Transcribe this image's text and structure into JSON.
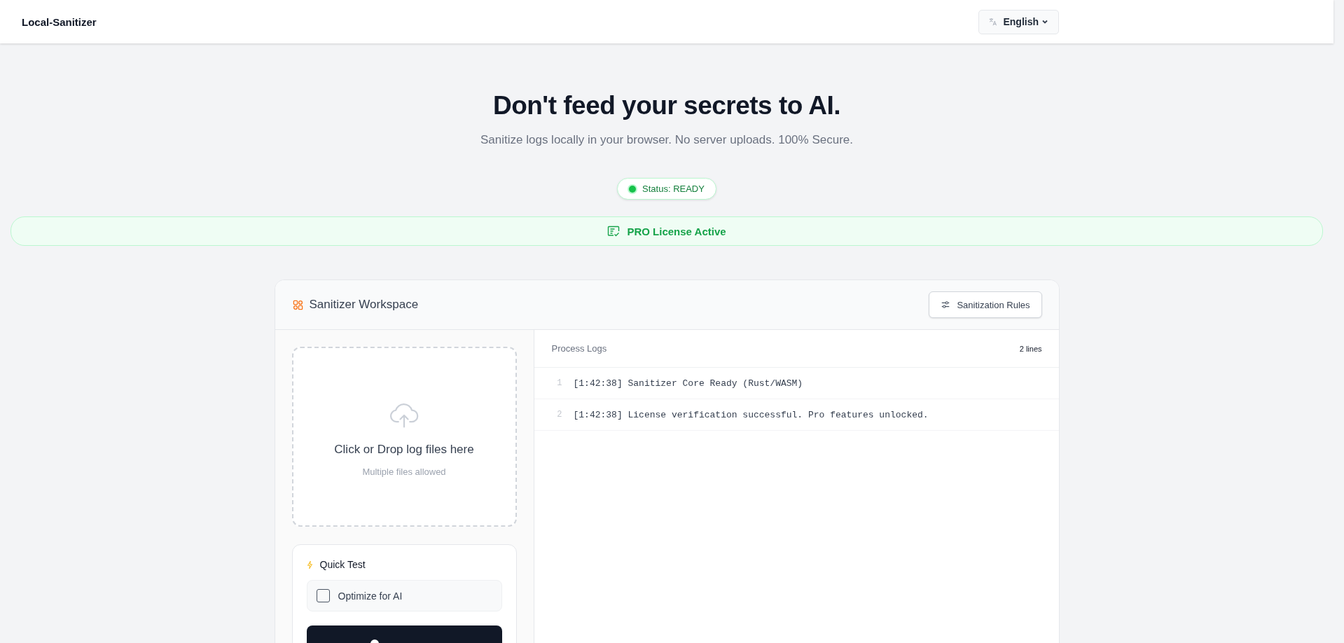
{
  "header": {
    "brand": "Local-Sanitizer",
    "language": {
      "label": "English"
    }
  },
  "hero": {
    "title": "Don't feed your secrets to AI.",
    "subtitle": "Sanitize logs locally in your browser. No server uploads. 100% Secure.",
    "status": {
      "label": "Status: READY",
      "ready": true
    }
  },
  "license_banner": {
    "label": "PRO License Active",
    "active": true
  },
  "workspace": {
    "title": "Sanitizer Workspace",
    "rules_button": "Sanitization Rules",
    "dropzone": {
      "title": "Click or Drop log files here",
      "hint": "Multiple files allowed"
    },
    "quick_test": {
      "title": "Quick Test",
      "options": [
        {
          "label": "Optimize for AI",
          "checked": false
        }
      ]
    },
    "logs": {
      "title": "Process Logs",
      "count": "2 lines",
      "lines": [
        {
          "number": "1",
          "text": "[1:42:38] Sanitizer Core Ready (Rust/WASM)"
        },
        {
          "number": "2",
          "text": "[1:42:38] License verification successful. Pro features unlocked."
        }
      ]
    }
  }
}
